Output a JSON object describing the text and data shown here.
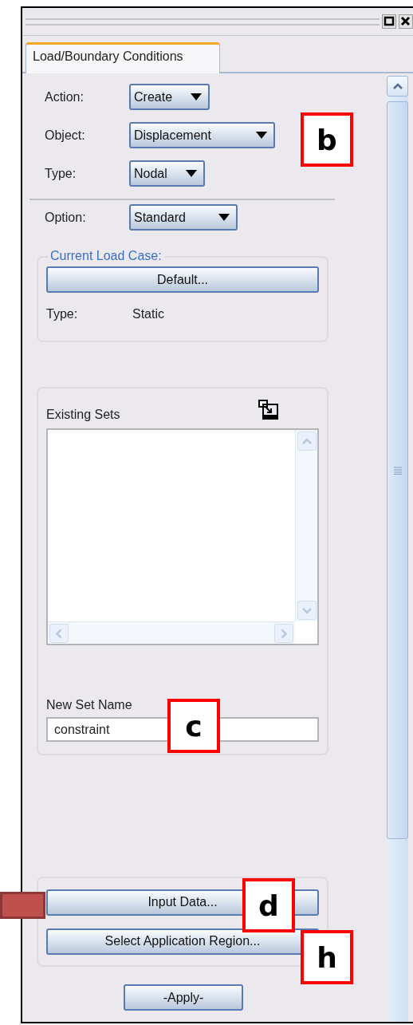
{
  "tabs": [
    {
      "label": "Load/Boundary Conditions",
      "selected": true
    }
  ],
  "selectors": [
    {
      "label": "Action:",
      "value": "Create"
    },
    {
      "label": "Object:",
      "value": "Displacement"
    },
    {
      "label": "Type:",
      "value": "Nodal"
    },
    {
      "label": "Option:",
      "value": "Standard"
    }
  ],
  "current_load_case": {
    "title": "Current Load Case:",
    "button": "Default...",
    "type_label": "Type:",
    "type_value": "Static"
  },
  "existing_sets": {
    "label": "Existing Sets"
  },
  "new_set_name": {
    "label": "New Set Name",
    "value": "constraint"
  },
  "buttons": [
    "Input Data...",
    "Select Application Region..."
  ],
  "apply": "-Apply-",
  "callouts": [
    {
      "label": "b"
    },
    {
      "label": "c"
    },
    {
      "label": "d"
    },
    {
      "label": "h"
    }
  ]
}
